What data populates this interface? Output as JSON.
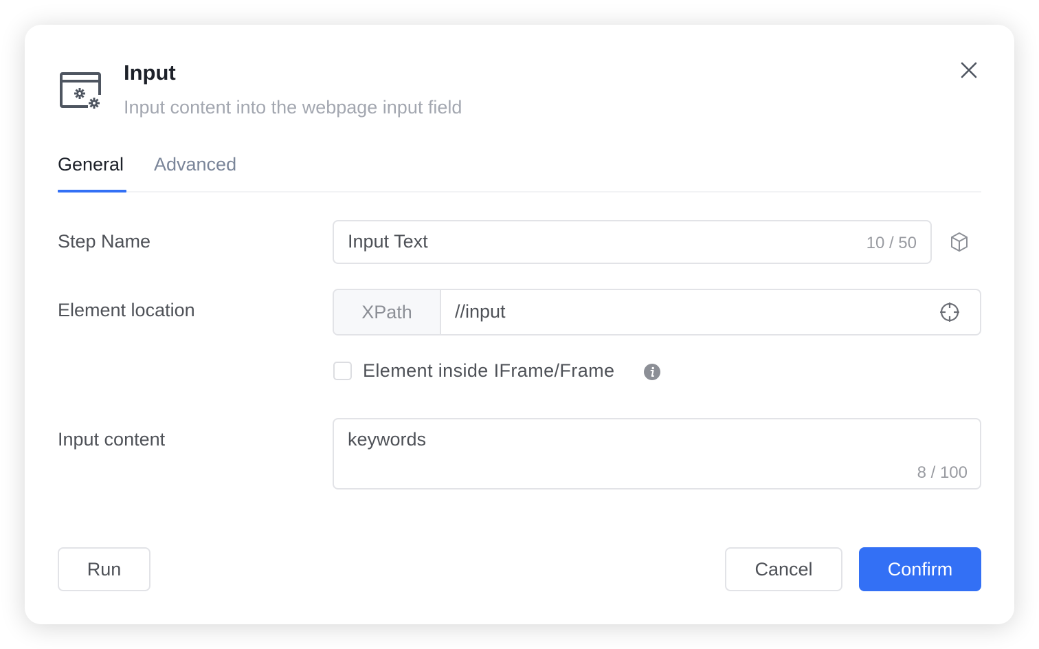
{
  "dialog": {
    "title": "Input",
    "subtitle": "Input content into the webpage input field",
    "icon": "browser-settings-icon"
  },
  "tabs": [
    {
      "label": "General",
      "active": true
    },
    {
      "label": "Advanced",
      "active": false
    }
  ],
  "form": {
    "step_name": {
      "label": "Step Name",
      "value": "Input Text",
      "counter": "10 / 50"
    },
    "element_location": {
      "label": "Element location",
      "type": "XPath",
      "value": "//input"
    },
    "iframe_checkbox": {
      "label": "Element inside IFrame/Frame",
      "checked": false
    },
    "input_content": {
      "label": "Input content",
      "value": "keywords",
      "counter": "8 / 100"
    }
  },
  "footer": {
    "run_label": "Run",
    "cancel_label": "Cancel",
    "confirm_label": "Confirm"
  },
  "colors": {
    "primary": "#3370f5",
    "title": "#1d2129",
    "subtitle": "#a3a7b0",
    "tab_inactive": "#7a8599",
    "label": "#4e5157",
    "border": "#e2e3e7"
  }
}
